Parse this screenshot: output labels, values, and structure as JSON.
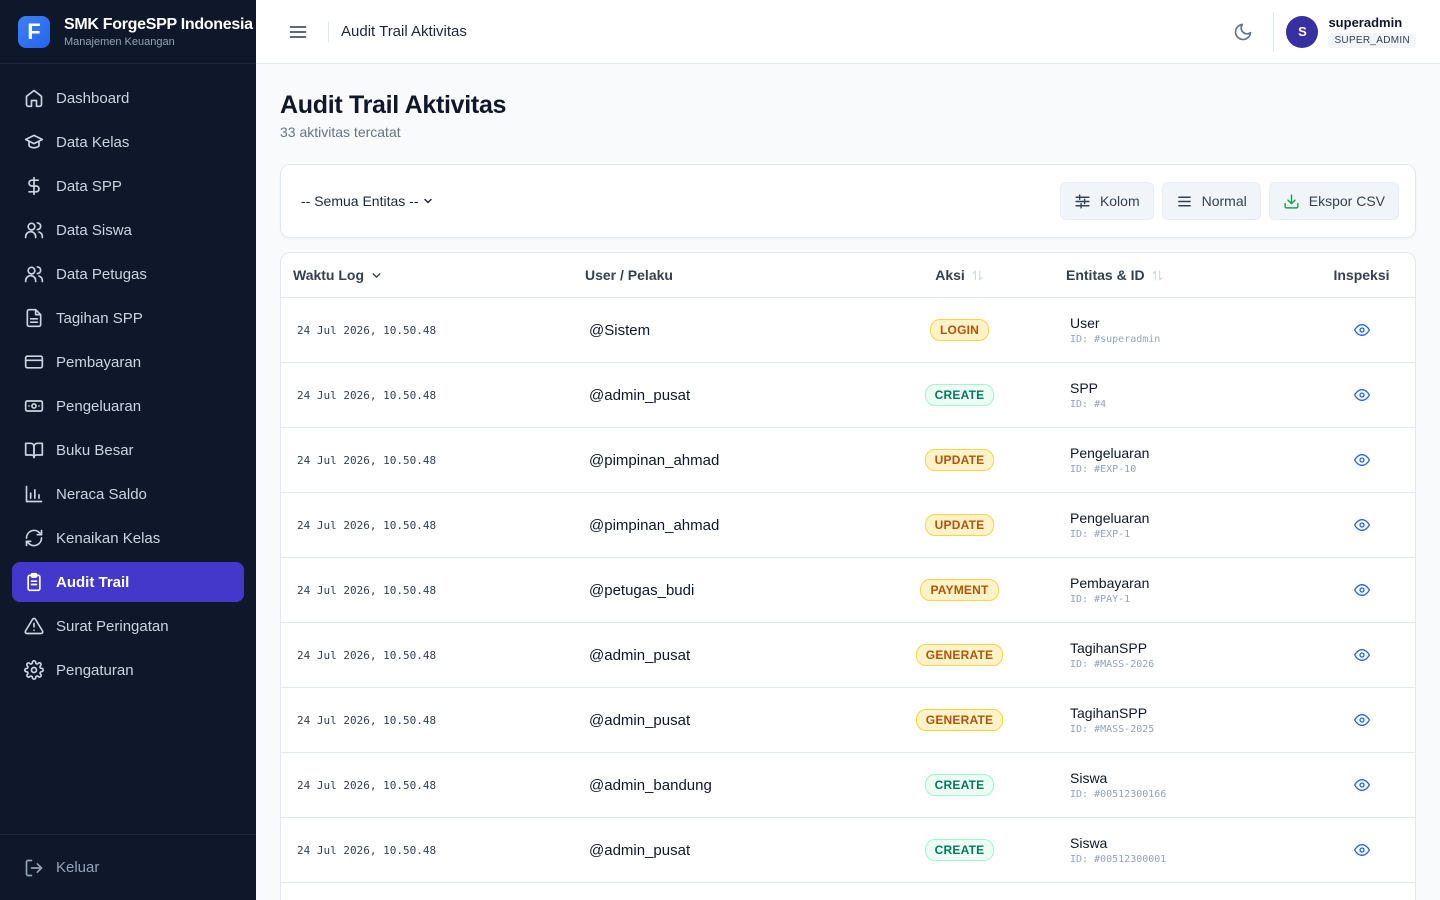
{
  "brand": {
    "logo": "F",
    "name": "SMK ForgeSPP Indonesia",
    "subtitle": "Manajemen Keuangan"
  },
  "sidebar": {
    "items": [
      {
        "label": "Dashboard",
        "icon": "home-icon"
      },
      {
        "label": "Data Kelas",
        "icon": "graduation-cap-icon"
      },
      {
        "label": "Data SPP",
        "icon": "dollar-icon"
      },
      {
        "label": "Data Siswa",
        "icon": "users-icon"
      },
      {
        "label": "Data Petugas",
        "icon": "users-icon"
      },
      {
        "label": "Tagihan SPP",
        "icon": "file-text-icon"
      },
      {
        "label": "Pembayaran",
        "icon": "credit-card-icon"
      },
      {
        "label": "Pengeluaran",
        "icon": "banknote-icon"
      },
      {
        "label": "Buku Besar",
        "icon": "book-icon"
      },
      {
        "label": "Neraca Saldo",
        "icon": "bar-chart-icon"
      },
      {
        "label": "Kenaikan Kelas",
        "icon": "refresh-icon"
      },
      {
        "label": "Audit Trail",
        "icon": "clipboard-icon",
        "active": true
      },
      {
        "label": "Surat Peringatan",
        "icon": "alert-triangle-icon"
      },
      {
        "label": "Pengaturan",
        "icon": "gear-icon"
      }
    ],
    "logout_label": "Keluar"
  },
  "header": {
    "title": "Audit Trail Aktivitas",
    "user": {
      "initial": "S",
      "name": "superadmin",
      "role": "SUPER_ADMIN"
    }
  },
  "page": {
    "title": "Audit Trail Aktivitas",
    "subtitle": "33 aktivitas tercatat"
  },
  "filter": {
    "entity_select": "-- Semua Entitas --",
    "btn_columns": "Kolom",
    "btn_density": "Normal",
    "btn_export": "Ekspor CSV"
  },
  "table": {
    "columns": {
      "time": "Waktu Log",
      "user": "User / Pelaku",
      "action": "Aksi",
      "entity": "Entitas & ID",
      "inspect": "Inspeksi"
    },
    "rows": [
      {
        "time": "24 Jul 2026, 10.50.48",
        "user": "@Sistem",
        "action": "LOGIN",
        "entity": "User",
        "entity_id": "ID: #superadmin"
      },
      {
        "time": "24 Jul 2026, 10.50.48",
        "user": "@admin_pusat",
        "action": "CREATE",
        "entity": "SPP",
        "entity_id": "ID: #4"
      },
      {
        "time": "24 Jul 2026, 10.50.48",
        "user": "@pimpinan_ahmad",
        "action": "UPDATE",
        "entity": "Pengeluaran",
        "entity_id": "ID: #EXP-10"
      },
      {
        "time": "24 Jul 2026, 10.50.48",
        "user": "@pimpinan_ahmad",
        "action": "UPDATE",
        "entity": "Pengeluaran",
        "entity_id": "ID: #EXP-1"
      },
      {
        "time": "24 Jul 2026, 10.50.48",
        "user": "@petugas_budi",
        "action": "PAYMENT",
        "entity": "Pembayaran",
        "entity_id": "ID: #PAY-1"
      },
      {
        "time": "24 Jul 2026, 10.50.48",
        "user": "@admin_pusat",
        "action": "GENERATE",
        "entity": "TagihanSPP",
        "entity_id": "ID: #MASS-2026"
      },
      {
        "time": "24 Jul 2026, 10.50.48",
        "user": "@admin_pusat",
        "action": "GENERATE",
        "entity": "TagihanSPP",
        "entity_id": "ID: #MASS-2025"
      },
      {
        "time": "24 Jul 2026, 10.50.48",
        "user": "@admin_bandung",
        "action": "CREATE",
        "entity": "Siswa",
        "entity_id": "ID: #00512300166"
      },
      {
        "time": "24 Jul 2026, 10.50.48",
        "user": "@admin_pusat",
        "action": "CREATE",
        "entity": "Siswa",
        "entity_id": "ID: #00512300001"
      }
    ]
  }
}
